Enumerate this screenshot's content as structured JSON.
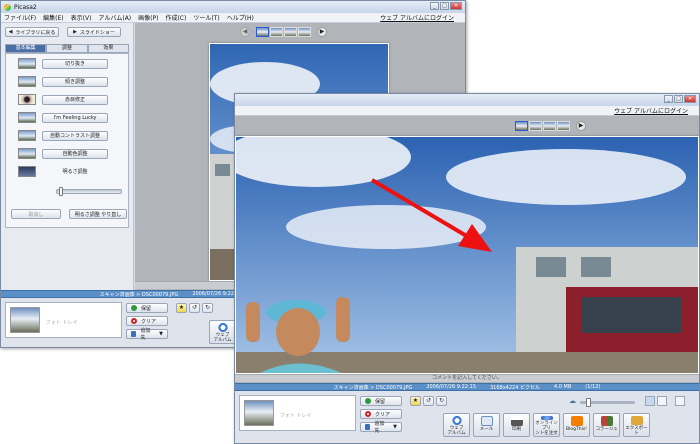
{
  "window_title": "Picasa2",
  "menu": [
    "ファイル(F)",
    "編集(E)",
    "表示(V)",
    "アルバム(A)",
    "画像(P)",
    "作成(C)",
    "ツール(T)",
    "ヘルプ(H)"
  ],
  "web_album_link": "ウェブ アルバムにログイン",
  "left_panel": {
    "back_button": "ライブラリに戻る",
    "slideshow_button": "スライドショー",
    "tabs": [
      "基本編集",
      "調整",
      "効果"
    ],
    "tools": [
      "切り抜き",
      "傾き調整",
      "赤目修正",
      "I'm Feeling Lucky",
      "自動コントラスト調整",
      "自動色調整",
      "明るさ調整"
    ],
    "undo_button": "取消し",
    "redo_button": "明るさ調整 やり直し"
  },
  "comment_placeholder": "コメントを記入してください。",
  "status": {
    "path": "スキャン済画像 > DSC00079.JPG",
    "date": "2006/07/26 9:22:15",
    "dims": "3168x4224 ピクセル",
    "size": "4.0 MB",
    "index": "(1/12)"
  },
  "tray": {
    "label": "フォト トレイ",
    "hold_button": "保留",
    "clear_button": "クリア",
    "add_button": "追加先"
  },
  "action_buttons": [
    {
      "label": "ウェブ\nアルバム",
      "icon": "web-album-icon",
      "color": "#3a7bd5"
    },
    {
      "label": "メール",
      "icon": "email-icon",
      "color": "#6a8fc4"
    },
    {
      "label": "印刷",
      "icon": "print-icon",
      "color": "#555555"
    },
    {
      "label": "オンラインプリ\nントを注文",
      "icon": "online-print-icon",
      "color": "#2c56a8"
    },
    {
      "label": "BlogThis!",
      "icon": "blogger-icon",
      "color": "#f57d00"
    },
    {
      "label": "コラージュ",
      "icon": "collage-icon",
      "color": "#b8453a"
    },
    {
      "label": "エクスポート",
      "icon": "export-icon",
      "color": "#e2a53a"
    }
  ]
}
